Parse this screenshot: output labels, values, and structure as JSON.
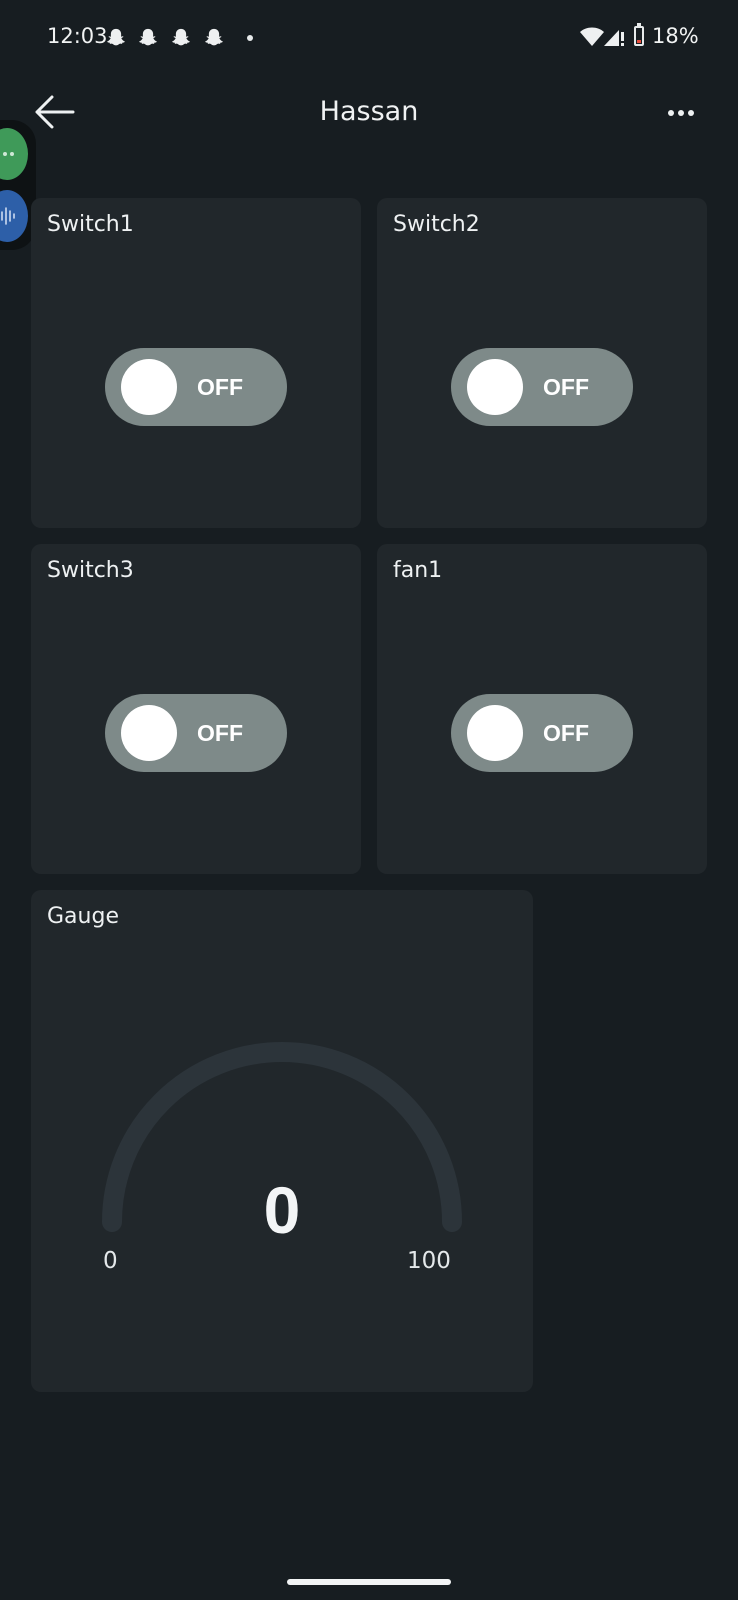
{
  "status_bar": {
    "time": "12:03",
    "notification_icons": [
      "snapchat-icon",
      "snapchat-icon",
      "snapchat-icon",
      "snapchat-icon"
    ],
    "battery_percent": "18%",
    "battery_level": 0.18,
    "battery_low_color": "#e74c3c"
  },
  "app_bar": {
    "title": "Hassan",
    "back_icon": "arrow-left-icon",
    "menu_icon": "more-dots-icon"
  },
  "widgets": {
    "switches": [
      {
        "title": "Switch1",
        "state": "OFF"
      },
      {
        "title": "Switch2",
        "state": "OFF"
      },
      {
        "title": "Switch3",
        "state": "OFF"
      },
      {
        "title": "fan1",
        "state": "OFF"
      }
    ],
    "gauge": {
      "title": "Gauge",
      "value": "0",
      "min": "0",
      "max": "100",
      "fill_fraction": 0
    }
  },
  "colors": {
    "background": "#171d21",
    "card": "#21272b",
    "toggle_off": "#7e8a89",
    "gauge_track": "#2c343a"
  }
}
